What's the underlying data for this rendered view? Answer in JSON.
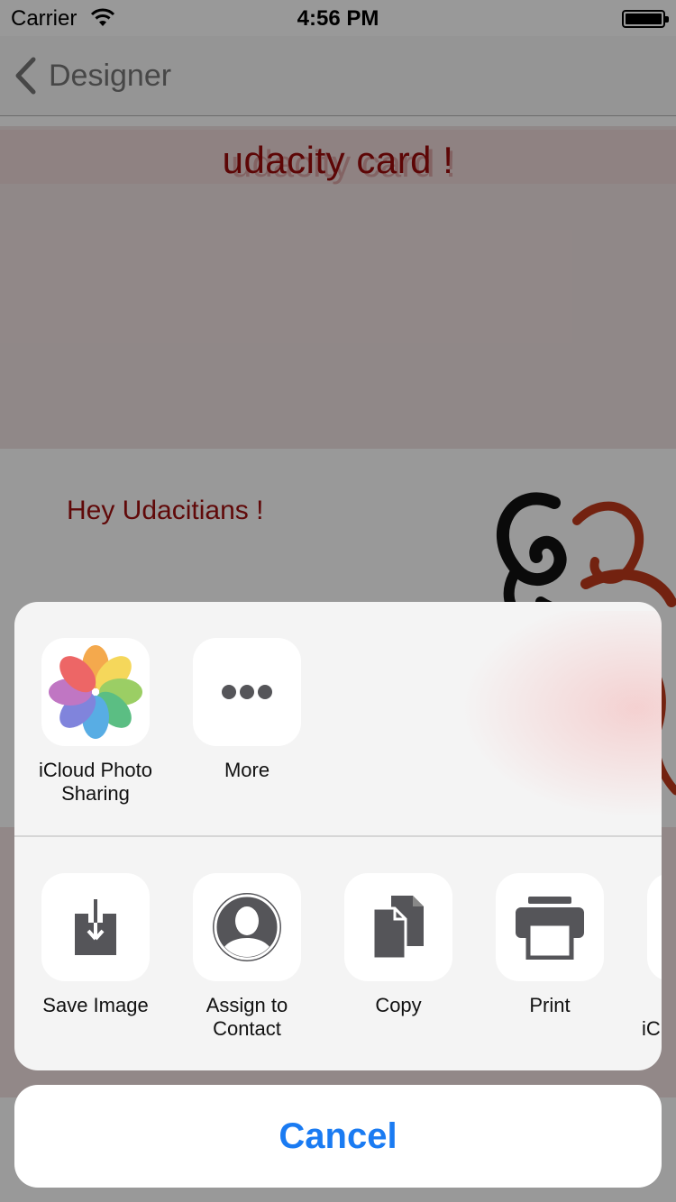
{
  "status_bar": {
    "carrier": "Carrier",
    "time": "4:56 PM"
  },
  "nav": {
    "back_label": "Designer"
  },
  "card": {
    "title": "udacity card !",
    "greeting": "Hey Udacitians !"
  },
  "share_sheet": {
    "apps": [
      {
        "label": "iCloud Photo\nSharing",
        "icon": "photos-icon"
      },
      {
        "label": "More",
        "icon": "more-icon"
      }
    ],
    "actions": [
      {
        "label": "Save Image",
        "icon": "save-image-icon"
      },
      {
        "label": "Assign to\nContact",
        "icon": "contact-icon"
      },
      {
        "label": "Copy",
        "icon": "copy-icon"
      },
      {
        "label": "Print",
        "icon": "print-icon"
      },
      {
        "label": "iC",
        "icon": "icloud-icon"
      }
    ],
    "cancel_label": "Cancel"
  },
  "colors": {
    "accent": "#1a7bf2",
    "card_text": "#9b0a0a",
    "icon_gray": "#555559"
  }
}
